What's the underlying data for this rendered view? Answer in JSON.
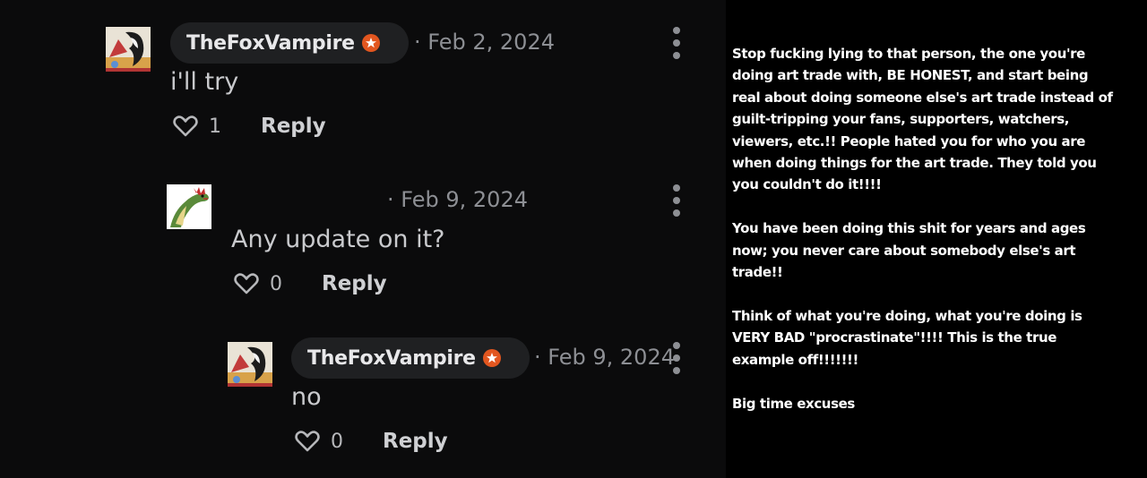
{
  "colors": {
    "thread_background": "#0b0b0c",
    "pill_background": "#1f2022",
    "badge_orange": "#e2561f",
    "caption_background": "#000000",
    "caption_text": "#ffffff"
  },
  "comments": [
    {
      "username": "TheFoxVampire",
      "has_badge": true,
      "timestamp": "· Feb 2, 2024",
      "body": "i'll try",
      "like_count": "1",
      "reply_label": "Reply",
      "icons": [
        "avatar-fox-icon",
        "kebab-menu-icon",
        "heart-icon"
      ]
    },
    {
      "username": "",
      "has_badge": false,
      "timestamp": "· Feb 9, 2024",
      "body": "Any update on it?",
      "like_count": "0",
      "reply_label": "Reply",
      "icons": [
        "avatar-dinosaur-icon",
        "kebab-menu-icon",
        "heart-icon"
      ]
    },
    {
      "username": "TheFoxVampire",
      "has_badge": true,
      "timestamp": "· Feb 9, 2024",
      "body": "no",
      "like_count": "0",
      "reply_label": "Reply",
      "icons": [
        "avatar-fox-icon",
        "kebab-menu-icon",
        "heart-icon"
      ]
    }
  ],
  "caption": {
    "paragraphs": [
      "Stop fucking lying to that person, the one you're doing art trade with, BE HONEST, and start being real about doing someone else's art trade instead of guilt-tripping your fans, supporters, watchers, viewers, etc.!! People hated you for who you are when doing things for the art trade. They told you you couldn't do it!!!!",
      "You have been doing this shit for years and ages now; you never care about somebody else's art trade!!",
      "Think of what you're doing, what you're doing is VERY BAD \"procrastinate\"!!!! This is the true example off!!!!!!!",
      "Big time excuses"
    ]
  }
}
